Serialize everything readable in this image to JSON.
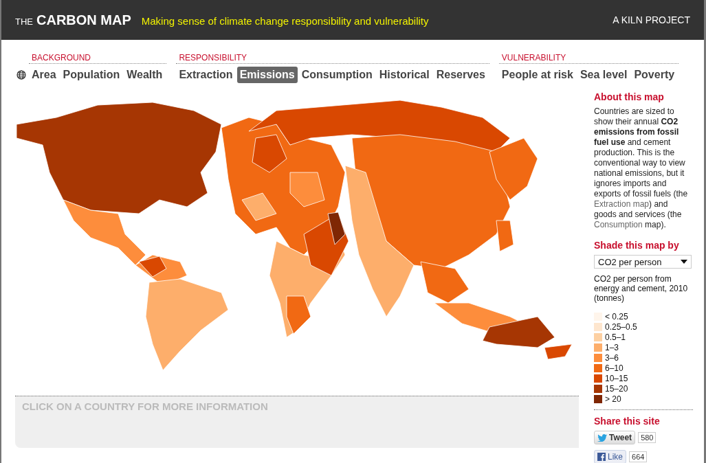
{
  "header": {
    "title_prefix": "THE",
    "title": "CARBON MAP",
    "tagline": "Making sense of climate change responsibility and vulnerability",
    "credit": "A KILN PROJECT"
  },
  "nav": [
    {
      "label": "BACKGROUND",
      "items": [
        {
          "label": "Area",
          "selected": false
        },
        {
          "label": "Population",
          "selected": false
        },
        {
          "label": "Wealth",
          "selected": false
        }
      ]
    },
    {
      "label": "RESPONSIBILITY",
      "items": [
        {
          "label": "Extraction",
          "selected": false
        },
        {
          "label": "Emissions",
          "selected": true
        },
        {
          "label": "Consumption",
          "selected": false
        },
        {
          "label": "Historical",
          "selected": false
        },
        {
          "label": "Reserves",
          "selected": false
        }
      ]
    },
    {
      "label": "VULNERABILITY",
      "items": [
        {
          "label": "People at risk",
          "selected": false
        },
        {
          "label": "Sea level",
          "selected": false
        },
        {
          "label": "Poverty",
          "selected": false
        }
      ]
    }
  ],
  "info_panel": {
    "text": "CLICK ON A COUNTRY FOR MORE INFORMATION"
  },
  "sidebar": {
    "about_title": "About this map",
    "about": [
      {
        "kind": "text",
        "text": "Countries are sized to show their annual **CO2 emissions from fossil fuel use** and cement production. This is the conventional way to view national emissions, but it ignores imports and exports of fossil fuels (the "
      },
      {
        "kind": "link",
        "text": "Extraction map"
      },
      {
        "kind": "text",
        "text": ") and goods and services (the "
      },
      {
        "kind": "link",
        "text": "Consumption"
      },
      {
        "kind": "text",
        "text": " map)."
      }
    ],
    "shade_title": "Shade this map by",
    "shade_value": "CO2 per person",
    "legend_title": "CO2 per person from energy and cement, 2010 (tonnes)",
    "legend": [
      {
        "label": "< 0.25",
        "color": "#fff5eb"
      },
      {
        "label": "0.25–0.5",
        "color": "#fee6ce"
      },
      {
        "label": "0.5–1",
        "color": "#fdd0a2"
      },
      {
        "label": "1–3",
        "color": "#fdae6b"
      },
      {
        "label": "3–6",
        "color": "#fd8d3c"
      },
      {
        "label": "6–10",
        "color": "#f16913"
      },
      {
        "label": "10–15",
        "color": "#d94801"
      },
      {
        "label": "15–20",
        "color": "#a63603"
      },
      {
        "label": "> 20",
        "color": "#7f2704"
      }
    ],
    "share_title": "Share this site",
    "tweet": {
      "label": "Tweet",
      "count": "580"
    },
    "like": {
      "label": "Like",
      "count": "664"
    }
  }
}
